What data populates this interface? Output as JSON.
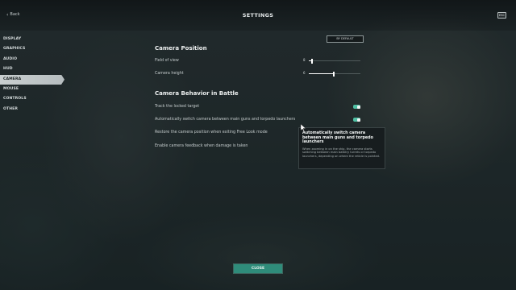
{
  "header": {
    "back_label": "Back",
    "title": "SETTINGS",
    "esc_label": "ESC"
  },
  "sidebar": {
    "items": [
      {
        "label": "DISPLAY"
      },
      {
        "label": "GRAPHICS"
      },
      {
        "label": "AUDIO"
      },
      {
        "label": "HUD"
      },
      {
        "label": "CAMERA",
        "active": true
      },
      {
        "label": "MOUSE"
      },
      {
        "label": "CONTROLS"
      },
      {
        "label": "OTHER"
      }
    ]
  },
  "main": {
    "default_button": "BY DEFAULT",
    "camera_position": {
      "title": "Camera Position",
      "field_of_view": {
        "label": "Field of view",
        "value": "8",
        "fraction": 0.06
      },
      "camera_height": {
        "label": "Camera height",
        "value": "6",
        "fraction": 0.48
      }
    },
    "camera_behavior": {
      "title": "Camera Behavior in Battle",
      "track_target": {
        "label": "Track the locked target",
        "on": true
      },
      "auto_switch": {
        "label": "Automatically switch camera between main guns and torpedo launchers",
        "on": true
      },
      "restore_position": {
        "label": "Restore the camera position when exiting Free Look mode"
      },
      "feedback": {
        "label": "Enable camera feedback when damage is taken"
      }
    }
  },
  "tooltip": {
    "title": "Automatically switch camera between main guns and torpedo launchers",
    "body": "When zooming in on the ship, the camera starts switching between main battery turrets or torpedo launchers, depending on where the reticle is pointed."
  },
  "footer": {
    "close_label": "CLOSE"
  },
  "colors": {
    "accent": "#4fbfa3",
    "close_button": "#2f8c7a",
    "active_tab": "#c9cfd0"
  }
}
